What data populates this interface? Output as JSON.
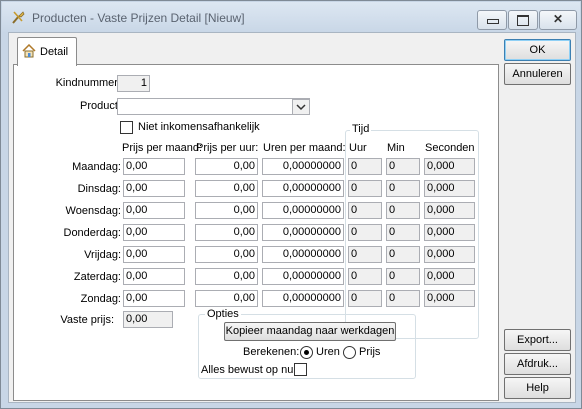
{
  "window": {
    "title": "Producten - Vaste Prijzen Detail [Nieuw]",
    "controls": {
      "minimize": "▭",
      "maximize": "▢",
      "close": "✕"
    }
  },
  "tab": {
    "label": "Detail"
  },
  "buttons": {
    "ok": "OK",
    "cancel": "Annuleren",
    "export": "Export...",
    "print": "Afdruk...",
    "help": "Help"
  },
  "form": {
    "kindnummer_label": "Kindnummer:",
    "kindnummer_value": "1",
    "product_label": "Product:",
    "product_value": "",
    "niet_inkomens_label": "Niet inkomensafhankelijk",
    "tijd_label": "Tijd",
    "headers": {
      "prijs_maand": "Prijs per maand:",
      "prijs_uur": "Prijs per uur:",
      "uren_maand": "Uren per maand:",
      "uur": "Uur",
      "min": "Min",
      "seconden": "Seconden"
    },
    "rows": [
      {
        "day": "Maandag:",
        "pm": "0,00",
        "pu": "0,00",
        "um": "0,00000000",
        "uur": "0",
        "min": "0",
        "sec": "0,000"
      },
      {
        "day": "Dinsdag:",
        "pm": "0,00",
        "pu": "0,00",
        "um": "0,00000000",
        "uur": "0",
        "min": "0",
        "sec": "0,000"
      },
      {
        "day": "Woensdag:",
        "pm": "0,00",
        "pu": "0,00",
        "um": "0,00000000",
        "uur": "0",
        "min": "0",
        "sec": "0,000"
      },
      {
        "day": "Donderdag:",
        "pm": "0,00",
        "pu": "0,00",
        "um": "0,00000000",
        "uur": "0",
        "min": "0",
        "sec": "0,000"
      },
      {
        "day": "Vrijdag:",
        "pm": "0,00",
        "pu": "0,00",
        "um": "0,00000000",
        "uur": "0",
        "min": "0",
        "sec": "0,000"
      },
      {
        "day": "Zaterdag:",
        "pm": "0,00",
        "pu": "0,00",
        "um": "0,00000000",
        "uur": "0",
        "min": "0",
        "sec": "0,000"
      },
      {
        "day": "Zondag:",
        "pm": "0,00",
        "pu": "0,00",
        "um": "0,00000000",
        "uur": "0",
        "min": "0",
        "sec": "0,000"
      }
    ],
    "vaste_prijs_label": "Vaste prijs:",
    "vaste_prijs_value": "0,00",
    "opties": {
      "title": "Opties",
      "copy_button": "Kopieer maandag naar werkdagen",
      "berekenen_label": "Berekenen:",
      "option_uren": "Uren",
      "option_prijs": "Prijs",
      "selected": "Uren",
      "alles_label": "Alles bewust op nul:"
    }
  },
  "colors": {
    "accent": "#3c7fb1",
    "titlebar": "#c9d7e7"
  }
}
